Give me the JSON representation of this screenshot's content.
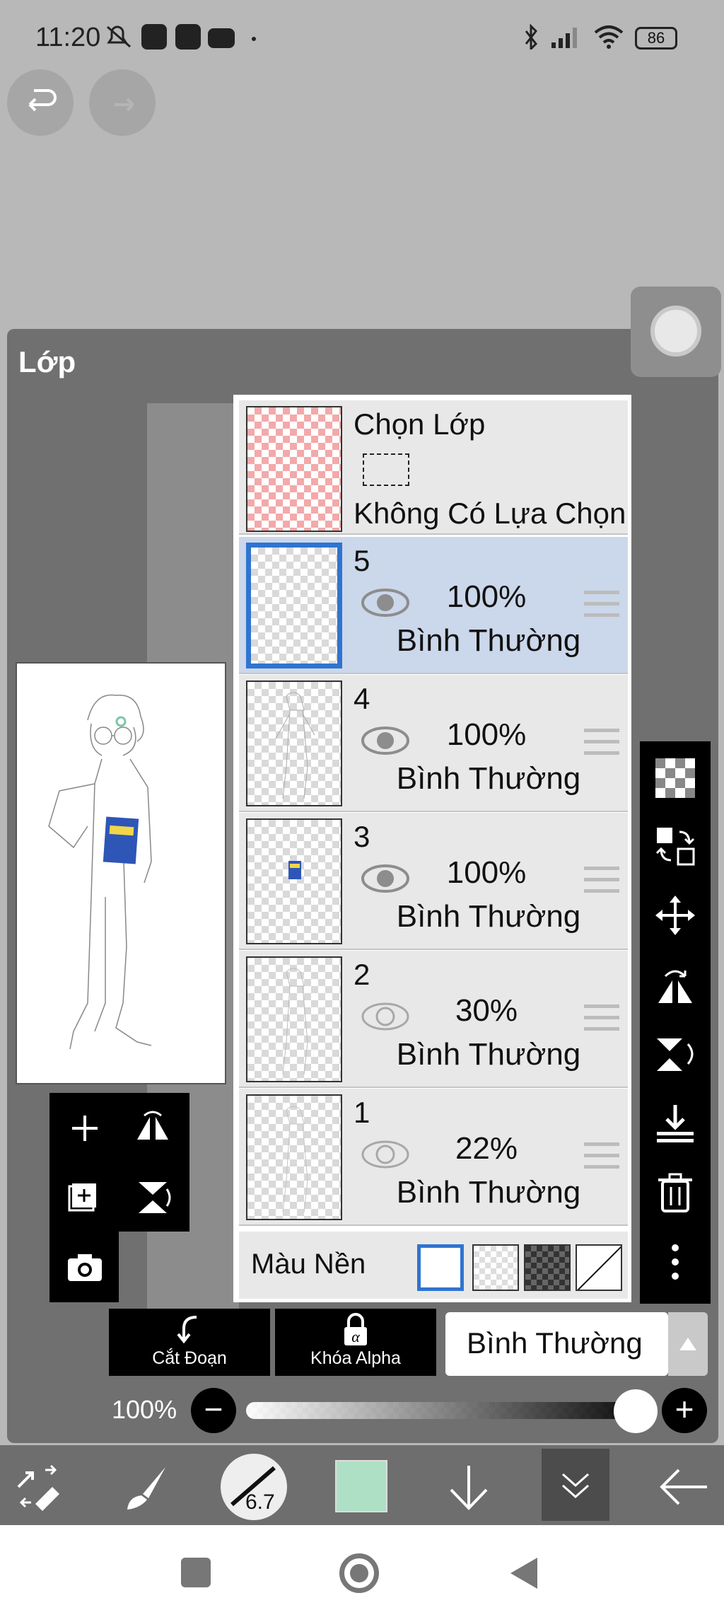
{
  "status_bar": {
    "time": "11:20",
    "battery": "86"
  },
  "panel": {
    "title": "Lớp"
  },
  "selection_row": {
    "title": "Chọn Lớp",
    "subtitle": "Không Có Lựa Chọn"
  },
  "layers": [
    {
      "num": "5",
      "opacity": "100%",
      "blend": "Bình Thường",
      "visible": true,
      "selected": true
    },
    {
      "num": "4",
      "opacity": "100%",
      "blend": "Bình Thường",
      "visible": true,
      "selected": false
    },
    {
      "num": "3",
      "opacity": "100%",
      "blend": "Bình Thường",
      "visible": true,
      "selected": false
    },
    {
      "num": "2",
      "opacity": "30%",
      "blend": "Bình Thường",
      "visible": false,
      "selected": false
    },
    {
      "num": "1",
      "opacity": "22%",
      "blend": "Bình Thường",
      "visible": false,
      "selected": false
    }
  ],
  "background": {
    "label": "Màu Nền"
  },
  "bottom": {
    "clip_label": "Cắt Đoạn",
    "alpha_label": "Khóa Alpha",
    "blend_mode": "Bình Thường",
    "opacity_label": "100%",
    "minus": "−",
    "plus": "+"
  },
  "toolbar": {
    "brush_size": "6.7",
    "color": "#aee0c6"
  }
}
